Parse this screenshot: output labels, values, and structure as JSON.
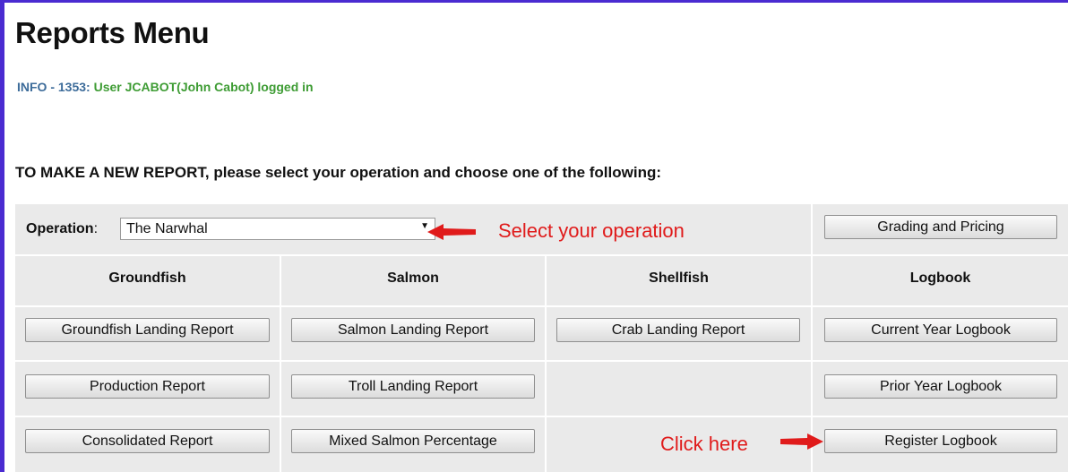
{
  "page": {
    "title": "Reports Menu",
    "info_code": "INFO - 1353:",
    "info_message": "User JCABOT(John Cabot) logged in",
    "instruction": "TO MAKE A NEW REPORT, please select your operation and choose one of the following:"
  },
  "operation": {
    "label": "Operation",
    "label_suffix": ":",
    "selected": "The Narwhal"
  },
  "annotations": {
    "select_hint": "Select your operation",
    "click_hint": "Click here",
    "arrow_color": "#e01b1b"
  },
  "buttons": {
    "grading_pricing": "Grading and Pricing"
  },
  "columns": {
    "groundfish": {
      "header": "Groundfish",
      "buttons": [
        "Groundfish Landing Report",
        "Production Report",
        "Consolidated Report"
      ]
    },
    "salmon": {
      "header": "Salmon",
      "buttons": [
        "Salmon Landing Report",
        "Troll Landing Report",
        "Mixed Salmon Percentage"
      ]
    },
    "shellfish": {
      "header": "Shellfish",
      "buttons": [
        "Crab Landing Report"
      ]
    },
    "logbook": {
      "header": "Logbook",
      "buttons": [
        "Current Year Logbook",
        "Prior Year Logbook",
        "Register Logbook"
      ]
    }
  },
  "colors": {
    "frame": "#4a2bd1",
    "info_code": "#3d6c9a",
    "info_message": "#3e9c34",
    "grid_bg": "#eaeaea"
  }
}
